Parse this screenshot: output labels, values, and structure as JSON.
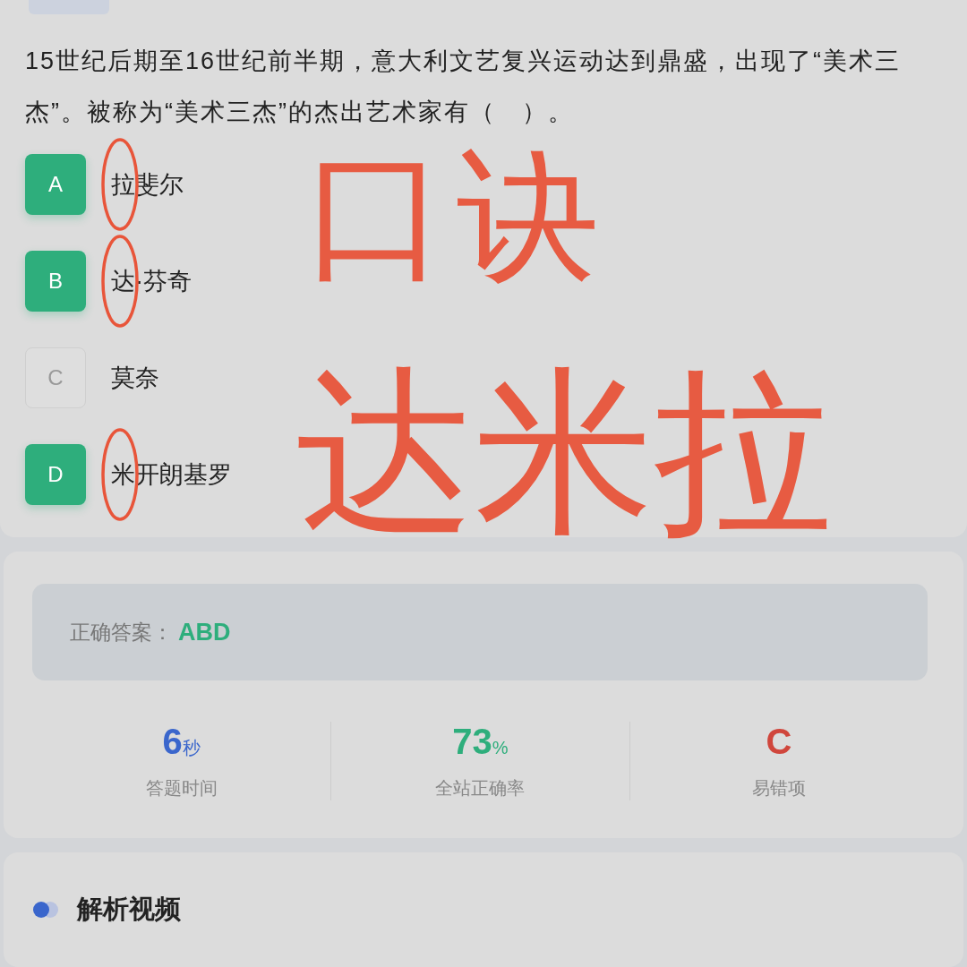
{
  "question": {
    "text": "15世纪后期至16世纪前半期，意大利文艺复兴运动达到鼎盛，出现了“美术三杰”。被称为“美术三杰”的杰出艺术家有（　）。",
    "options": [
      {
        "letter": "A",
        "text": "拉斐尔",
        "selected": true,
        "circled": true
      },
      {
        "letter": "B",
        "text": "达·芬奇",
        "selected": true,
        "circled": true
      },
      {
        "letter": "C",
        "text": "莫奈",
        "selected": false,
        "circled": false
      },
      {
        "letter": "D",
        "text": "米开朗基罗",
        "selected": true,
        "circled": true
      }
    ]
  },
  "handwriting": [
    {
      "text": "口诀"
    },
    {
      "text": "达米拉"
    }
  ],
  "answer": {
    "label": "正确答案：",
    "value": "ABD"
  },
  "stats": [
    {
      "value": "6",
      "unit": "秒",
      "label": "答题时间",
      "color": "#3a66cc"
    },
    {
      "value": "73",
      "unit": "%",
      "label": "全站正确率",
      "color": "#2eae7c"
    },
    {
      "value": "C",
      "label": "易错项",
      "color": "#d0463c"
    }
  ],
  "video_section": {
    "title": "解析视频"
  }
}
